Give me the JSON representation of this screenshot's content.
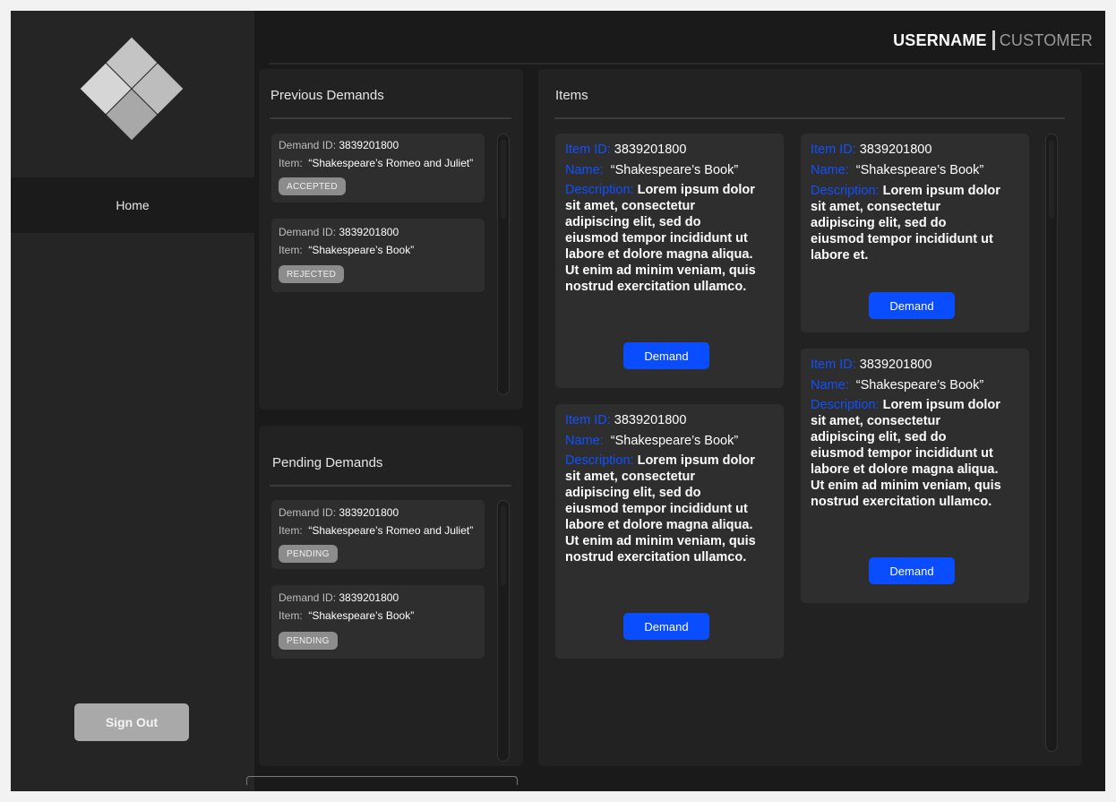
{
  "header": {
    "username": "USERNAME",
    "role": "CUSTOMER"
  },
  "sidebar": {
    "logo_icon": "diamond-grid-logo",
    "nav": [
      {
        "label": "Home"
      }
    ],
    "signout_label": "Sign Out"
  },
  "previous_demands": {
    "title": "Previous Demands",
    "cards": [
      {
        "id_label": "Demand ID:",
        "id": "3839201800",
        "item_label": "Item:",
        "item": "“Shakespeare’s Romeo and Juliet”",
        "status": "ACCEPTED"
      },
      {
        "id_label": "Demand ID:",
        "id": "3839201800",
        "item_label": "Item:",
        "item": "“Shakespeare’s Book”",
        "status": "REJECTED"
      }
    ]
  },
  "pending_demands": {
    "title": "Pending Demands",
    "cards": [
      {
        "id_label": "Demand ID:",
        "id": "3839201800",
        "item_label": "Item:",
        "item": "“Shakespeare’s Romeo and Juliet”",
        "status": "PENDING"
      },
      {
        "id_label": "Demand ID:",
        "id": "3839201800",
        "item_label": "Item:",
        "item": "“Shakespeare’s Book”",
        "status": "PENDING"
      }
    ]
  },
  "items": {
    "title": "Items",
    "cards": [
      {
        "id_label": "Item ID:",
        "id": "3839201800",
        "name_label": "Name:",
        "name": "“Shakespeare’s Book”",
        "desc_label": "Description:",
        "description": "Lorem ipsum dolor sit amet, consectetur adipiscing elit, sed do eiusmod tempor incididunt ut labore et dolore magna aliqua. Ut enim ad minim veniam, quis nostrud exercitation ullamco.",
        "button": "Demand"
      },
      {
        "id_label": "Item ID:",
        "id": "3839201800",
        "name_label": "Name:",
        "name": "“Shakespeare’s Book”",
        "desc_label": "Description:",
        "description": "Lorem ipsum dolor sit amet, consectetur adipiscing elit, sed do eiusmod tempor incididunt ut labore et.",
        "button": "Demand"
      },
      {
        "id_label": "Item ID:",
        "id": "3839201800",
        "name_label": "Name:",
        "name": "“Shakespeare’s Book”",
        "desc_label": "Description:",
        "description": "Lorem ipsum dolor sit amet, consectetur adipiscing elit, sed do eiusmod tempor incididunt ut labore et dolore magna aliqua. Ut enim ad minim veniam, quis nostrud exercitation ullamco.",
        "button": "Demand"
      },
      {
        "id_label": "Item ID:",
        "id": "3839201800",
        "name_label": "Name:",
        "name": "“Shakespeare’s Book”",
        "desc_label": "Description:",
        "description": "Lorem ipsum dolor sit amet, consectetur adipiscing elit, sed do eiusmod tempor incididunt ut labore et dolore magna aliqua. Ut enim ad minim veniam, quis nostrud exercitation ullamco.",
        "button": "Demand"
      }
    ]
  },
  "colors": {
    "accent": "#0a4dff",
    "label_blue": "#1050ff",
    "badge": "#8c8c8c"
  }
}
